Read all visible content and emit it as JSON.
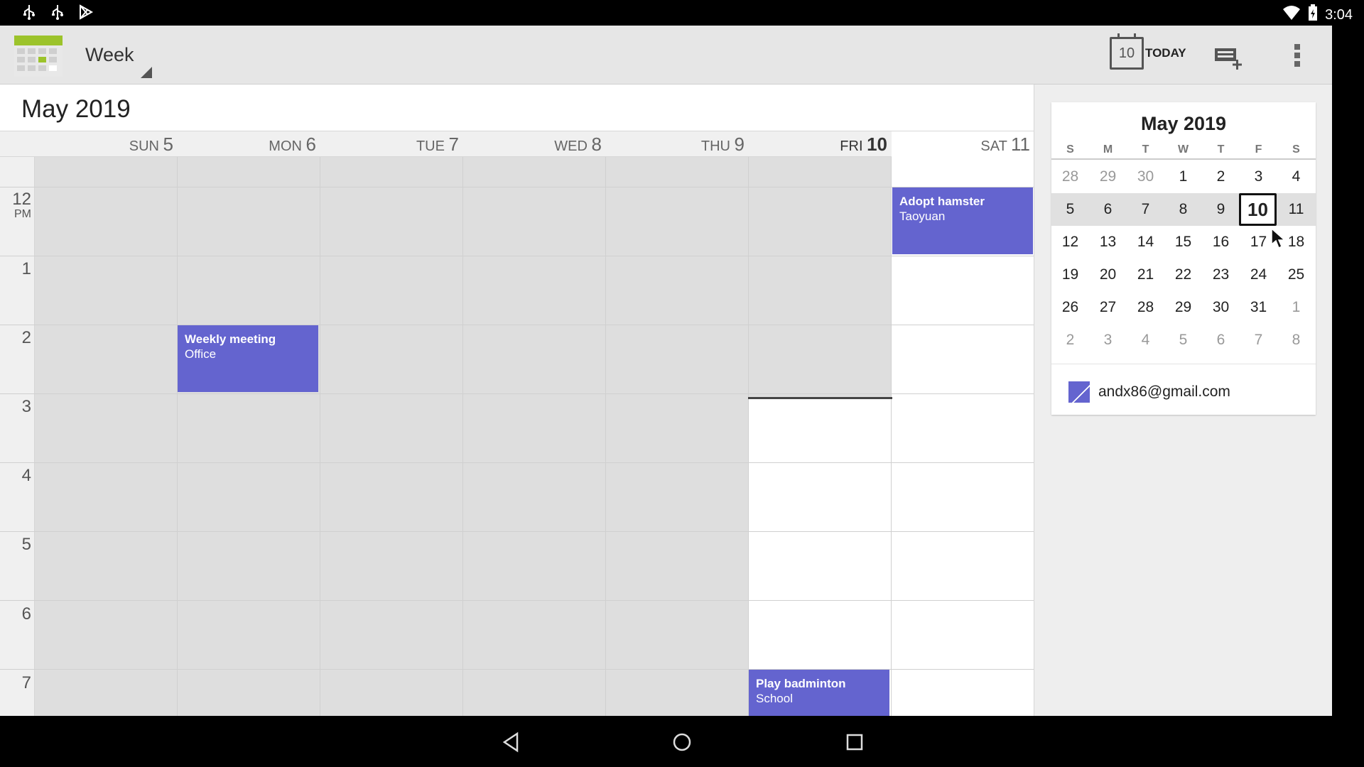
{
  "status_bar": {
    "time": "3:04"
  },
  "toolbar": {
    "view_label": "Week",
    "today_day": "10",
    "today_label": "TODAY"
  },
  "week": {
    "month_title": "May 2019",
    "days": [
      {
        "dow": "SUN",
        "num": "5"
      },
      {
        "dow": "MON",
        "num": "6"
      },
      {
        "dow": "TUE",
        "num": "7"
      },
      {
        "dow": "WED",
        "num": "8"
      },
      {
        "dow": "THU",
        "num": "9"
      },
      {
        "dow": "FRI",
        "num": "10"
      },
      {
        "dow": "SAT",
        "num": "11"
      }
    ],
    "hours": [
      "12",
      "1",
      "2",
      "3",
      "4",
      "5",
      "6",
      "7"
    ],
    "pm_label": "PM",
    "events": [
      {
        "title": "Adopt hamster",
        "location": "Taoyuan"
      },
      {
        "title": "Weekly meeting",
        "location": "Office"
      },
      {
        "title": "Play badminton",
        "location": "School"
      }
    ]
  },
  "minical": {
    "title": "May 2019",
    "dow": [
      "S",
      "M",
      "T",
      "W",
      "T",
      "F",
      "S"
    ],
    "weeks": [
      [
        "28",
        "29",
        "30",
        "1",
        "2",
        "3",
        "4"
      ],
      [
        "5",
        "6",
        "7",
        "8",
        "9",
        "10",
        "11"
      ],
      [
        "12",
        "13",
        "14",
        "15",
        "16",
        "17",
        "18"
      ],
      [
        "19",
        "20",
        "21",
        "22",
        "23",
        "24",
        "25"
      ],
      [
        "26",
        "27",
        "28",
        "29",
        "30",
        "31",
        "1"
      ],
      [
        "2",
        "3",
        "4",
        "5",
        "6",
        "7",
        "8"
      ]
    ],
    "selected": "10",
    "account": "andx86@gmail.com"
  },
  "colors": {
    "event": "#6464cf",
    "past_bg": "#dedede",
    "toolbar_bg": "#e6e6e6"
  }
}
